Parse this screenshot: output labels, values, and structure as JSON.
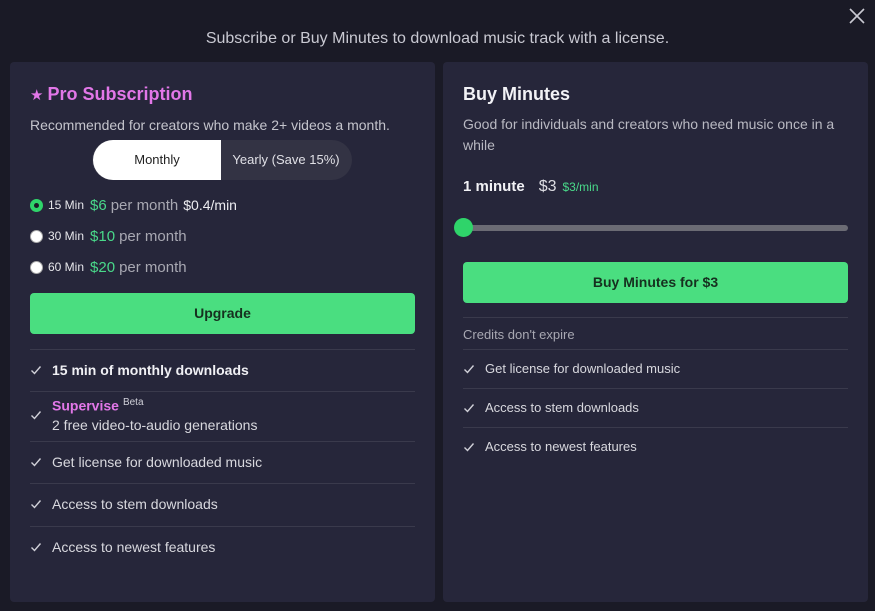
{
  "header": {
    "title": "Subscribe or Buy Minutes to download music track with a license."
  },
  "close_icon": "close-icon",
  "pro": {
    "title": "Pro Subscription",
    "subtitle": "Recommended for creators who make 2+ videos a month.",
    "toggle": {
      "monthly": "Monthly",
      "yearly": "Yearly (Save 15%)",
      "selected": "Monthly"
    },
    "plans": [
      {
        "min": "15 Min",
        "price": "$6",
        "per": "per month",
        "rate": "$0.4/min",
        "checked": true
      },
      {
        "min": "30 Min",
        "price": "$10",
        "per": "per month",
        "rate": "",
        "checked": false
      },
      {
        "min": "60 Min",
        "price": "$20",
        "per": "per month",
        "rate": "",
        "checked": false
      }
    ],
    "upgrade_label": "Upgrade",
    "features": {
      "f1": "15 min of monthly downloads",
      "supervise": "Supervise",
      "beta": "Beta",
      "supervise_desc": "2 free video-to-audio generations",
      "f3": "Get license for downloaded music",
      "f4": "Access to stem downloads",
      "f5": "Access to newest features"
    }
  },
  "buy": {
    "title": "Buy Minutes",
    "desc": "Good for individuals and creators who need music once in a while",
    "minute_label": "1 minute",
    "price": "$3",
    "rate": "$3/min",
    "slider_value": 1,
    "button_label": "Buy Minutes for $3",
    "credits": "Credits don't expire",
    "features": {
      "f1": "Get license for downloaded music",
      "f2": "Access to stem downloads",
      "f3": "Access to newest features"
    }
  },
  "colors": {
    "accent_green": "#4ade80",
    "pink": "#e277e8",
    "card_bg": "#26263a",
    "page_bg": "#1a1a26"
  }
}
